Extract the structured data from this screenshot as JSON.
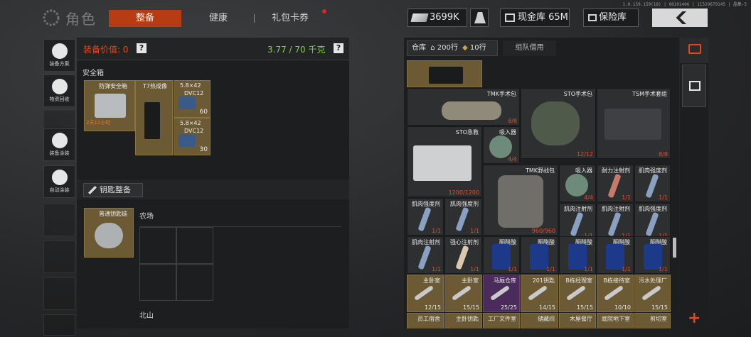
{
  "version_text": "1.0.159.159(18) | 08191406 | 11529679145 | 晶集-5",
  "header": {
    "title": "角色",
    "tabs": [
      {
        "label": "整备",
        "active": true
      },
      {
        "label": "健康",
        "active": false
      },
      {
        "label": "礼包卡券",
        "active": false,
        "notification": true
      }
    ],
    "money": "3699K",
    "cash_warehouse": "现金库 65M",
    "vault": "保险库"
  },
  "sidebar": {
    "items": [
      {
        "label": "装备方案",
        "icon": "loadout-icon"
      },
      {
        "label": "物资回收",
        "icon": "recycle-icon"
      },
      {
        "label": "装备涂装",
        "icon": "helmet-paint-icon"
      },
      {
        "label": "自动涂装",
        "icon": "auto-paint-icon"
      }
    ]
  },
  "equipment": {
    "value_label": "装备价值: 0",
    "weight": "3.77 / 70 千克",
    "safe_box_label": "安全箱",
    "safe_box": {
      "name": "防弹安全箱",
      "timer": "2天11小时"
    },
    "thermal": {
      "name": "T7热成像"
    },
    "ammo": [
      {
        "name": "5.8×42",
        "sub": "DVC12",
        "count": "60"
      },
      {
        "name": "5.8×42",
        "sub": "DVC12",
        "count": "30"
      }
    ],
    "key_section": {
      "button": "钥匙整备",
      "keychain": "普通钥匙链",
      "farm_label": "农场",
      "north_label": "北山"
    }
  },
  "warehouse": {
    "tab_label": "仓库",
    "rows_main": "200行",
    "rows_extra": "10行",
    "team_tab": "组队借用",
    "items": [
      {
        "name": "TMK手术包",
        "count": "8/8",
        "rarity": "normal"
      },
      {
        "name": "STO手术包",
        "count": "12/12",
        "rarity": "normal"
      },
      {
        "name": "TSM手术套组",
        "count": "8/8",
        "rarity": "normal"
      },
      {
        "name": "STO急救",
        "count": "1200/1200",
        "rarity": "normal"
      },
      {
        "name": "吸入器",
        "count": "4/4",
        "rarity": "normal"
      },
      {
        "name": "TMK野战包",
        "count": "960/960",
        "rarity": "normal"
      },
      {
        "name": "吸入器",
        "count": "4/4",
        "rarity": "normal"
      },
      {
        "name": "耐力注射剂",
        "count": "1/1",
        "rarity": "normal"
      },
      {
        "name": "肌肉强度剂",
        "count": "1/1",
        "rarity": "normal"
      },
      {
        "name": "肌肉强度剂",
        "count": "1/1",
        "rarity": "normal"
      },
      {
        "name": "肌肉强度剂",
        "count": "1/1",
        "rarity": "normal"
      },
      {
        "name": "肌肉注射剂",
        "count": "1/1",
        "rarity": "normal"
      },
      {
        "name": "肌肉注射剂",
        "count": "1/1",
        "rarity": "normal"
      },
      {
        "name": "肌肉强度剂",
        "count": "1/1",
        "rarity": "normal"
      },
      {
        "name": "肌肉注射剂",
        "count": "1/1",
        "rarity": "normal"
      },
      {
        "name": "强心注射剂",
        "count": "1/1",
        "rarity": "normal"
      },
      {
        "name": "酮醋酸",
        "count": "1/1",
        "rarity": "normal"
      },
      {
        "name": "酮醋酸",
        "count": "1/1",
        "rarity": "normal"
      },
      {
        "name": "酮醋酸",
        "count": "1/1",
        "rarity": "normal"
      },
      {
        "name": "酮醋酸",
        "count": "1/1",
        "rarity": "normal"
      },
      {
        "name": "酮醋酸",
        "count": "1/1",
        "rarity": "normal"
      },
      {
        "name": "主卧室",
        "count": "12/15",
        "rarity": "gold"
      },
      {
        "name": "主卧室",
        "count": "15/15",
        "rarity": "gold"
      },
      {
        "name": "马厩仓库",
        "count": "25/25",
        "rarity": "purple"
      },
      {
        "name": "201钥匙",
        "count": "14/15",
        "rarity": "gold"
      },
      {
        "name": "B栋经理室",
        "count": "15/15",
        "rarity": "gold"
      },
      {
        "name": "B栋接待室",
        "count": "10/10",
        "rarity": "gold"
      },
      {
        "name": "污水处理厂",
        "count": "15/15",
        "rarity": "gold"
      },
      {
        "name": "员工宿舍",
        "count": "",
        "rarity": "gold"
      },
      {
        "name": "主卧钥匙",
        "count": "",
        "rarity": "gold"
      },
      {
        "name": "工厂文件室",
        "count": "",
        "rarity": "gold"
      },
      {
        "name": "储藏间",
        "count": "",
        "rarity": "gold"
      },
      {
        "name": "木屋餐厅",
        "count": "",
        "rarity": "gold"
      },
      {
        "name": "庭院地下室",
        "count": "",
        "rarity": "gold"
      },
      {
        "name": "剪切室",
        "count": "",
        "rarity": "gold"
      }
    ]
  },
  "colors": {
    "accent": "#b73c14",
    "weight_green": "#7ad43a",
    "count_red": "#e84a2a",
    "gold": "#6b5a34",
    "purple": "#4a2b5c"
  }
}
